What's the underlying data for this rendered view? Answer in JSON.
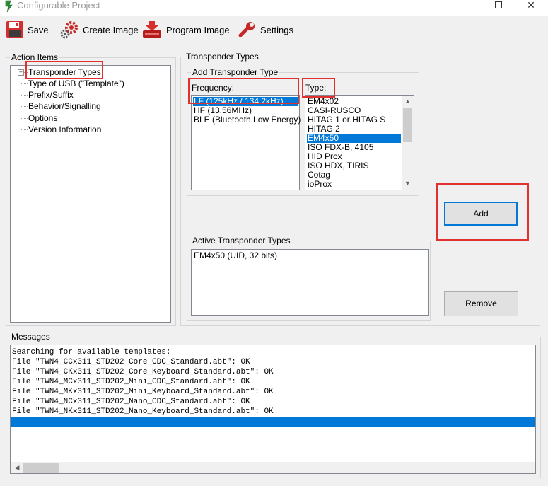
{
  "window": {
    "title": "Configurable Project",
    "controls": [
      "minimize-icon",
      "maximize-icon",
      "close-icon"
    ]
  },
  "toolbar": {
    "save_label": "Save",
    "create_image_label": "Create Image",
    "program_image_label": "Program Image",
    "settings_label": "Settings"
  },
  "action_items": {
    "legend": "Action Items",
    "items": [
      "Transponder Types",
      "Type of USB (\"Template\")",
      "Prefix/Suffix",
      "Behavior/Signalling",
      "Options",
      "Version Information"
    ]
  },
  "transponder_types": {
    "legend": "Transponder Types",
    "add_group": {
      "legend": "Add Transponder Type",
      "frequency_label": "Frequency:",
      "frequencies": [
        "LF (125kHz / 134.2kHz)",
        "HF (13.56MHz)",
        "BLE (Bluetooth Low Energy)"
      ],
      "selected_frequency": 0,
      "type_label": "Type:",
      "types": [
        "EM4x02",
        "CASI-RUSCO",
        "HITAG 1 or HITAG S",
        "HITAG 2",
        "EM4x50",
        "ISO FDX-B, 4105",
        "HID Prox",
        "ISO HDX, TIRIS",
        "Cotag",
        "ioProx"
      ],
      "selected_type": 4,
      "add_label": "Add"
    },
    "active_group": {
      "legend": "Active Transponder Types",
      "items": [
        "EM4x50 (UID, 32 bits)"
      ],
      "remove_label": "Remove"
    }
  },
  "messages": {
    "legend": "Messages",
    "lines": [
      "Searching for available templates:",
      "File \"TWN4_CCx311_STD202_Core_CDC_Standard.abt\": OK",
      "File \"TWN4_CKx311_STD202_Core_Keyboard_Standard.abt\": OK",
      "File \"TWN4_MCx311_STD202_Mini_CDC_Standard.abt\": OK",
      "File \"TWN4_MKx311_STD202_Mini_Keyboard_Standard.abt\": OK",
      "File \"TWN4_NCx311_STD202_Nano_CDC_Standard.abt\": OK",
      "File \"TWN4_NKx311_STD202_Nano_Keyboard_Standard.abt\": OK"
    ]
  },
  "colors": {
    "selection": "#0078d7",
    "highlight_box": "#e03030"
  }
}
